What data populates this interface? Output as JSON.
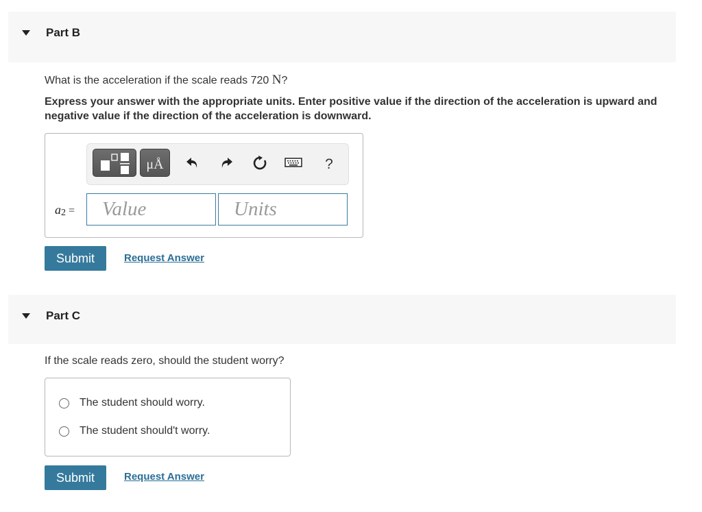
{
  "part_b": {
    "title": "Part B",
    "question_prefix": "What is the acceleration if the scale reads 720 ",
    "question_unit": "N",
    "question_suffix": "?",
    "instructions": "Express your answer with the appropriate units. Enter positive value if the direction of the acceleration is upward and negative value if the direction of the acceleration is downward.",
    "variable": "a",
    "variable_sub": "2",
    "equals": "=",
    "toolbar": {
      "templates_icon": "fraction-template-icon",
      "units_label": "μÅ",
      "undo_icon": "undo-icon",
      "redo_icon": "redo-icon",
      "reset_icon": "reset-icon",
      "keyboard_icon": "keyboard-icon",
      "help_label": "?"
    },
    "value_placeholder": "Value",
    "value": "",
    "units_placeholder": "Units",
    "units": "",
    "submit_label": "Submit",
    "request_answer_label": "Request Answer"
  },
  "part_c": {
    "title": "Part C",
    "question": "If the scale reads zero, should the student worry?",
    "options": [
      {
        "label": "The student should worry.",
        "selected": false
      },
      {
        "label": "The student should't worry.",
        "selected": false
      }
    ],
    "submit_label": "Submit",
    "request_answer_label": "Request Answer"
  },
  "colors": {
    "header_bg": "#f7f7f7",
    "submit_bg": "#357a9c",
    "link": "#2a6e96",
    "field_border": "#3a7aa0"
  }
}
